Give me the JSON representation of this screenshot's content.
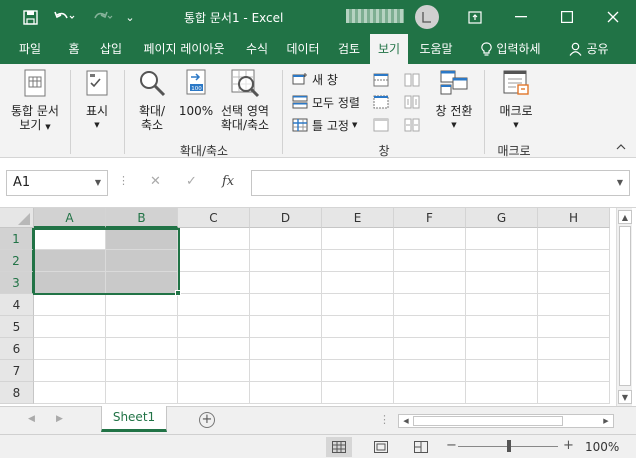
{
  "titlebar": {
    "title": "통합 문서1  -  Excel",
    "avatar_initial": "LJ",
    "customize_glyph": "⌄"
  },
  "ribbon_tabs": [
    {
      "label": "파일",
      "active": false
    },
    {
      "label": "홈",
      "active": false
    },
    {
      "label": "삽입",
      "active": false
    },
    {
      "label": "페이지 레이아웃",
      "active": false
    },
    {
      "label": "수식",
      "active": false
    },
    {
      "label": "데이터",
      "active": false
    },
    {
      "label": "검토",
      "active": false
    },
    {
      "label": "보기",
      "active": true
    },
    {
      "label": "도움말",
      "active": false
    }
  ],
  "tellme": {
    "label": "입력하세"
  },
  "share": {
    "label": "공유"
  },
  "ribbon": {
    "workbook_view": {
      "line1": "통합 문서",
      "line2": "보기"
    },
    "show": {
      "label": "표시"
    },
    "zoom_group": {
      "zoom": {
        "line1": "확대/",
        "line2": "축소"
      },
      "hundred": {
        "label": "100%"
      },
      "selection": {
        "line1": "선택 영역",
        "line2": "확대/축소"
      },
      "group_label": "확대/축소"
    },
    "window_group": {
      "new_window": "새 창",
      "arrange_all": "모두 정렬",
      "freeze": "틀 고정",
      "switch_windows": "창 전환",
      "group_label": "창"
    },
    "macro_group": {
      "macro": "매크로",
      "group_label": "매크로"
    }
  },
  "formula_bar": {
    "namebox": "A1",
    "fx": "fx",
    "formula": ""
  },
  "columns": [
    "A",
    "B",
    "C",
    "D",
    "E",
    "F",
    "G",
    "H"
  ],
  "rows": [
    "1",
    "2",
    "3",
    "4",
    "5",
    "6",
    "7",
    "8"
  ],
  "selection": {
    "range": "A1:B3",
    "active_cell": "A1"
  },
  "sheets": [
    {
      "name": "Sheet1",
      "active": true
    }
  ],
  "status": {
    "zoom": "100%"
  },
  "colors": {
    "accent": "#217346",
    "selection_fill": "#c9c9c9"
  }
}
